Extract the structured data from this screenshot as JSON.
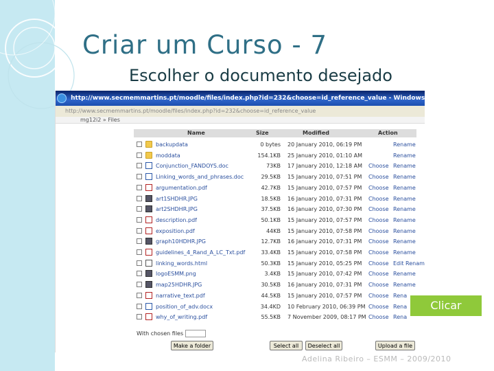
{
  "slide": {
    "title": "Criar um Curso - 7",
    "subtitle": "Escolher o documento desejado",
    "callout_label": "Clicar",
    "footer": "Adelina Ribeiro – ESMM – 2009/2010"
  },
  "browser": {
    "window_title": "http://www.secmemmartins.pt/moodle/files/index.php?id=232&choose=id_reference_value - Windows Internet Explorer",
    "address": "http://www.secmemmartins.pt/moodle/files/index.php?id=232&choose=id_reference_value",
    "breadcrumb": "mg12i2 » Files"
  },
  "table": {
    "headers": {
      "name": "Name",
      "size": "Size",
      "modified": "Modified",
      "action": "Action"
    },
    "rows": [
      {
        "icon": "folder-icon",
        "name": "backupdata",
        "size": "0 bytes",
        "modified": "20 January 2010, 06:19 PM",
        "choose": "",
        "action": "Rename"
      },
      {
        "icon": "folder-icon",
        "name": "moddata",
        "size": "154.1KB",
        "modified": "25 January 2010, 01:10 AM",
        "choose": "",
        "action": "Rename"
      },
      {
        "icon": "doc-icon",
        "name": "Conjunction_FANDOYS.doc",
        "size": "73KB",
        "modified": "17 January 2010, 12:18 AM",
        "choose": "Choose",
        "action": "Rename"
      },
      {
        "icon": "doc-icon",
        "name": "Linking_words_and_phrases.doc",
        "size": "29.5KB",
        "modified": "15 January 2010, 07:51 PM",
        "choose": "Choose",
        "action": "Rename"
      },
      {
        "icon": "pdf-icon",
        "name": "argumentation.pdf",
        "size": "42.7KB",
        "modified": "15 January 2010, 07:57 PM",
        "choose": "Choose",
        "action": "Rename"
      },
      {
        "icon": "image-icon",
        "name": "art1SHDHR.JPG",
        "size": "18.5KB",
        "modified": "16 January 2010, 07:31 PM",
        "choose": "Choose",
        "action": "Rename"
      },
      {
        "icon": "image-icon",
        "name": "art2SHDHR.JPG",
        "size": "37.5KB",
        "modified": "16 January 2010, 07:30 PM",
        "choose": "Choose",
        "action": "Rename"
      },
      {
        "icon": "pdf-icon",
        "name": "description.pdf",
        "size": "50.1KB",
        "modified": "15 January 2010, 07:57 PM",
        "choose": "Choose",
        "action": "Rename"
      },
      {
        "icon": "pdf-icon",
        "name": "exposition.pdf",
        "size": "44KB",
        "modified": "15 January 2010, 07:58 PM",
        "choose": "Choose",
        "action": "Rename"
      },
      {
        "icon": "image-icon",
        "name": "graph10HDHR.JPG",
        "size": "12.7KB",
        "modified": "16 January 2010, 07:31 PM",
        "choose": "Choose",
        "action": "Rename"
      },
      {
        "icon": "pdf-icon",
        "name": "guidelines_4_Rand_A_LC_Txt.pdf",
        "size": "33.4KB",
        "modified": "15 January 2010, 07:58 PM",
        "choose": "Choose",
        "action": "Rename"
      },
      {
        "icon": "html-icon",
        "name": "linking_words.html",
        "size": "50.3KB",
        "modified": "15 January 2010, 05:25 PM",
        "choose": "Choose",
        "action": "Edit Rename"
      },
      {
        "icon": "image-icon",
        "name": "logoESMM.png",
        "size": "3.4KB",
        "modified": "15 January 2010, 07:42 PM",
        "choose": "Choose",
        "action": "Rename"
      },
      {
        "icon": "image-icon",
        "name": "map25HDHR.JPG",
        "size": "30.5KB",
        "modified": "16 January 2010, 07:31 PM",
        "choose": "Choose",
        "action": "Rename"
      },
      {
        "icon": "pdf-icon",
        "name": "narrative_text.pdf",
        "size": "44.5KB",
        "modified": "15 January 2010, 07:57 PM",
        "choose": "Choose",
        "action": "Rena"
      },
      {
        "icon": "doc-icon",
        "name": "position_of_adv.docx",
        "size": "34.4KD",
        "modified": "10 February 2010, 06:39 PM",
        "choose": "Choose",
        "action": "Rena"
      },
      {
        "icon": "pdf-icon",
        "name": "why_of_writing.pdf",
        "size": "55.5KB",
        "modified": "7 November 2009, 08:17 PM",
        "choose": "Choose",
        "action": "Rena"
      }
    ]
  },
  "controls": {
    "with_chosen_label": "With chosen files",
    "make_folder": "Make a folder",
    "select_all": "Select all",
    "deselect_all": "Deselect all",
    "upload": "Upload a file"
  }
}
